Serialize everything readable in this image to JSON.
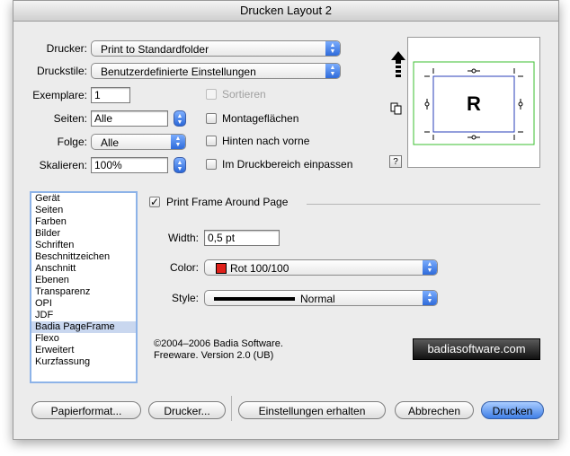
{
  "window": {
    "title": "Drucken Layout 2"
  },
  "form": {
    "printer": {
      "label": "Drucker:",
      "value": "Print to Standardfolder"
    },
    "preset": {
      "label": "Druckstile:",
      "value": "Benutzerdefinierte Einstellungen"
    },
    "copies": {
      "label": "Exemplare:",
      "value": "1"
    },
    "pages": {
      "label": "Seiten:",
      "value": "Alle"
    },
    "order": {
      "label": "Folge:",
      "value": "Alle"
    },
    "scale": {
      "label": "Skalieren:",
      "value": "100%"
    }
  },
  "checkboxes": {
    "collate": {
      "label": "Sortieren",
      "checked": false,
      "enabled": false
    },
    "tiling": {
      "label": "Montageflächen",
      "checked": false
    },
    "back_to_front": {
      "label": "Hinten nach vorne",
      "checked": false
    },
    "fit_in_print_area": {
      "label": "Im Druckbereich einpassen",
      "checked": false
    }
  },
  "preview": {
    "letter": "R",
    "help": "?"
  },
  "categories": {
    "items": [
      "Gerät",
      "Seiten",
      "Farben",
      "Bilder",
      "Schriften",
      "Beschnittzeichen",
      "Anschnitt",
      "Ebenen",
      "Transparenz",
      "OPI",
      "JDF",
      "Badia PageFrame",
      "Flexo",
      "Erweitert",
      "Kurzfassung"
    ],
    "selected": "Badia PageFrame"
  },
  "pageframe": {
    "enable_label": "Print Frame Around Page",
    "enabled": true,
    "width": {
      "label": "Width:",
      "value": "0,5 pt"
    },
    "color": {
      "label": "Color:",
      "value": "Rot 100/100",
      "swatch": "#e0201a"
    },
    "style": {
      "label": "Style:",
      "value": "Normal"
    },
    "copyright_line1": "©2004–2006 Badia Software.",
    "copyright_line2": "Freeware. Version 2.0 (UB)",
    "badge": "badiasoftware.com"
  },
  "buttons": {
    "page_setup": "Papierformat...",
    "printer": "Drucker...",
    "save_settings": "Einstellungen erhalten",
    "cancel": "Abbrechen",
    "print": "Drucken"
  }
}
